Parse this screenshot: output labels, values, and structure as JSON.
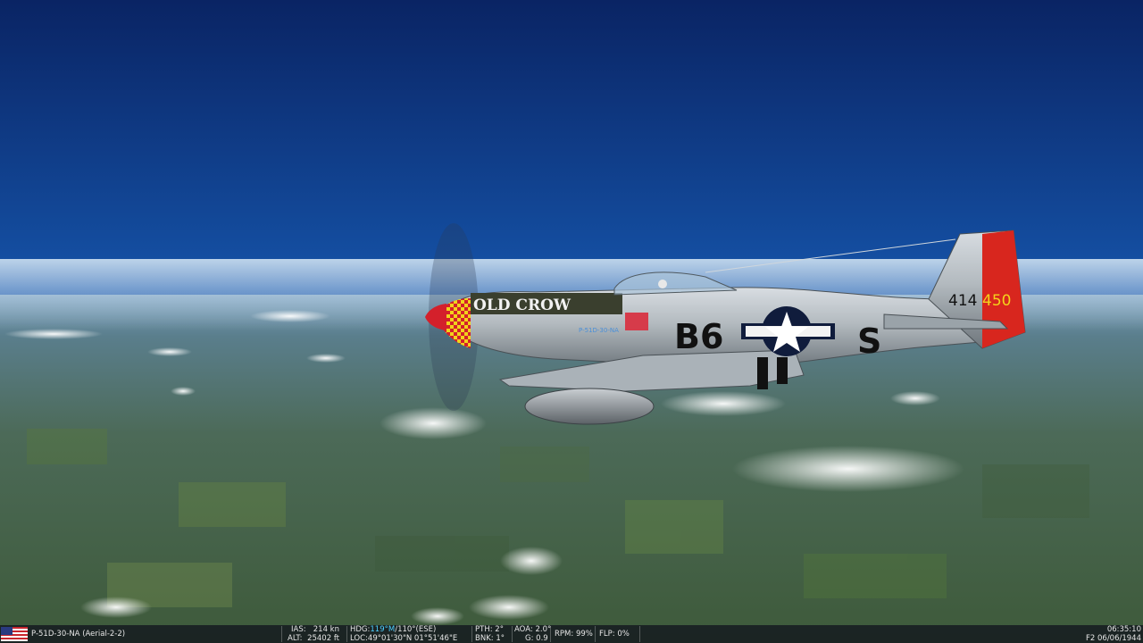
{
  "aircraft": {
    "nose_art": "OLD CROW",
    "codes": "B6",
    "letter": "S",
    "serial": "414",
    "tail_number": "450",
    "stencil": "P-51D-30-NA"
  },
  "hud": {
    "flag_icon": "us-flag-icon",
    "unit_label": "P-51D-30-NA (Aerial-2-2)",
    "ias_label": "IAS:",
    "ias_value": "214 kn",
    "alt_label": "ALT:",
    "alt_value": "25402 ft",
    "hdg_label": "HDG:",
    "hdg_value": "119°M",
    "hdg_true": "/110°(ESE)",
    "loc_label": "LOC:",
    "loc_value": "49°01'30\"N 01°51'46\"E",
    "pth_label": "PTH:",
    "pth_value": "2°",
    "bnk_label": "BNK:",
    "bnk_value": "1°",
    "aoa_label": "AOA:",
    "aoa_value": "2.0°",
    "g_label": "G:",
    "g_value": "0.9",
    "rpm_label": "RPM:",
    "rpm_value": "99%",
    "flp_label": "FLP:",
    "flp_value": "0%",
    "time": "06:35:10",
    "date": "F2 06/06/1944"
  }
}
